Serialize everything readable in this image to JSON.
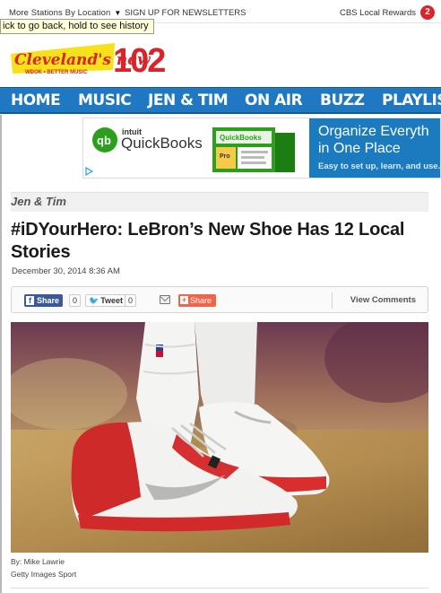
{
  "topbar": {
    "stations_label": "More Stations By Location",
    "stations_caret": "▼",
    "newsletter_label": "SIGN UP FOR NEWSLETTERS",
    "rewards_label": "CBS Local Rewards",
    "rewards_count": "2"
  },
  "tooltip": "ick to go back, hold to see history",
  "logo": {
    "name_text": "Cleveland's new",
    "number_text": "102",
    "tagline": "WDOK • BETTER MUSIC"
  },
  "nav": {
    "items": [
      "HOME",
      "MUSIC",
      "JEN & TIM",
      "ON AIR",
      "BUZZ",
      "PLAYLIS"
    ]
  },
  "ad": {
    "brand_small": "intuit",
    "brand": "QuickBooks",
    "box_label": "QuickBooks",
    "box_tag": "Pro",
    "headline_line1": "Organize Everyth",
    "headline_line2": "in One Place",
    "subline": "Easy to set up, learn, and use."
  },
  "article": {
    "section": "Jen & Tim",
    "headline": "#iDYourHero: LeBron’s New Shoe Has 12 Local Stories",
    "date": "December 30, 2014 8:36 AM"
  },
  "share": {
    "facebook_label": "Share",
    "facebook_count": "0",
    "tweet_label": "Tweet",
    "tweet_count": "0",
    "share_label": "Share",
    "comments_label": "View Comments"
  },
  "photo": {
    "credit_by": "By: Mike Lawrie",
    "credit_source": "Getty Images Sport"
  },
  "colors": {
    "nav_blue": "#1f78c1",
    "badge_red": "#d9242b",
    "facebook_blue": "#3b5998",
    "share_orange": "#f06449",
    "quickbooks_green": "#2ca01c"
  }
}
